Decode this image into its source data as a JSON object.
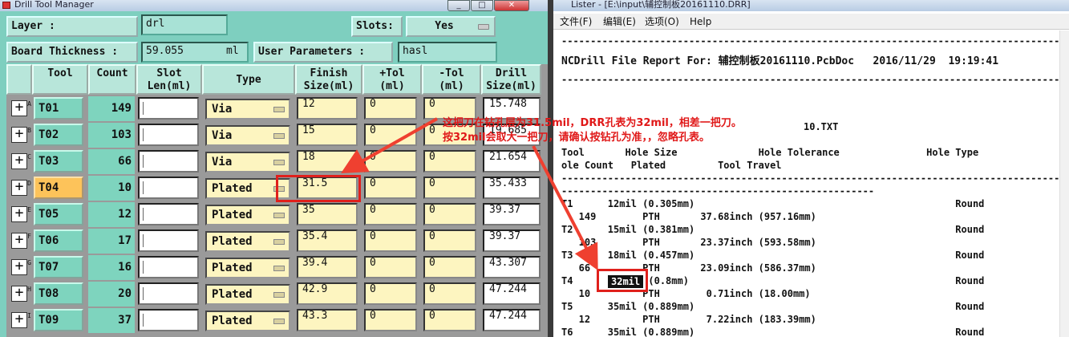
{
  "dtm": {
    "title": "Drill Tool Manager",
    "win_buttons": [
      "_",
      "□",
      "✕"
    ],
    "layer_label": "Layer :",
    "layer_value": "drl",
    "slots_label": "Slots:",
    "slots_value": "Yes",
    "thickness_label": "Board Thickness :",
    "thickness_value": "59.055",
    "thickness_unit": "ml",
    "userparam_label": "User Parameters :",
    "userparam_value": "hasl",
    "headers": {
      "tool": "Tool",
      "count": "Count",
      "slot1": "Slot",
      "slot2": "Len(ml)",
      "type": "Type",
      "finish1": "Finish",
      "finish2": "Size(ml)",
      "ptol1": "+Tol",
      "ptol2": "(ml)",
      "mtol1": "-Tol",
      "mtol2": "(ml)",
      "drill1": "Drill",
      "drill2": "Size(ml)"
    },
    "rows": [
      {
        "tool": "T01",
        "count": "149",
        "type": "Via",
        "finish": "12",
        "ptol": "0",
        "mtol": "0",
        "drill": "15.748",
        "sup": "A"
      },
      {
        "tool": "T02",
        "count": "103",
        "type": "Via",
        "finish": "15",
        "ptol": "0",
        "mtol": "0",
        "drill": "19.685",
        "sup": "B"
      },
      {
        "tool": "T03",
        "count": "66",
        "type": "Via",
        "finish": "18",
        "ptol": "0",
        "mtol": "0",
        "drill": "21.654",
        "sup": "C"
      },
      {
        "tool": "T04",
        "count": "10",
        "type": "Plated",
        "finish": "31.5",
        "ptol": "0",
        "mtol": "0",
        "drill": "35.433",
        "sup": "D"
      },
      {
        "tool": "T05",
        "count": "12",
        "type": "Plated",
        "finish": "35",
        "ptol": "0",
        "mtol": "0",
        "drill": "39.37",
        "sup": "E"
      },
      {
        "tool": "T06",
        "count": "17",
        "type": "Plated",
        "finish": "35.4",
        "ptol": "0",
        "mtol": "0",
        "drill": "39.37",
        "sup": "F"
      },
      {
        "tool": "T07",
        "count": "16",
        "type": "Plated",
        "finish": "39.4",
        "ptol": "0",
        "mtol": "0",
        "drill": "43.307",
        "sup": "G"
      },
      {
        "tool": "T08",
        "count": "20",
        "type": "Plated",
        "finish": "42.9",
        "ptol": "0",
        "mtol": "0",
        "drill": "47.244",
        "sup": "H"
      },
      {
        "tool": "T09",
        "count": "37",
        "type": "Plated",
        "finish": "43.3",
        "ptol": "0",
        "mtol": "0",
        "drill": "47.244",
        "sup": "I"
      }
    ]
  },
  "lister": {
    "title": "Lister - [E:\\input\\辅控制板20161110.DRR]",
    "menu": [
      "文件(F)",
      "编辑(E)",
      "选项(O)",
      "Help"
    ],
    "dash1": "--------------------------------------------------------------------------------------------------",
    "report_title": "NCDrill File Report For: 辅控制板20161110.PcbDoc   2016/11/29  19:19:41",
    "dash2": "--------------------------------------------------------------------------------------------------",
    "file_line": "10.TXT",
    "hdr1": "Tool       Hole Size              Hole Tolerance               Hole Type",
    "hdr2": "ole Count   Plated         Tool Travel",
    "dash3": "--------------------------------------------------------------------------------------------------",
    "dash4": "------------------------------------------------------",
    "entries": [
      {
        "a": "T1      12mil (0.305mm)                                             Round",
        "b": "   149        PTH       37.68inch (957.16mm)"
      },
      {
        "a": "T2      15mil (0.381mm)                                             Round",
        "b": "   103        PTH       23.37inch (593.58mm)"
      },
      {
        "a": "T3      18mil (0.457mm)                                             Round",
        "b": "   66         PTH       23.09inch (586.37mm)"
      },
      {
        "a": "T4             (0.8mm)                                              Round",
        "b": "   10         PTH        0.71inch (18.00mm)"
      },
      {
        "a": "T5      35mil (0.889mm)                                             Round",
        "b": "   12         PTH        7.22inch (183.39mm)"
      },
      {
        "a": "T6      35mil (0.889mm)                                             Round",
        "b": ""
      }
    ],
    "highlight": "32mil"
  },
  "annotation": {
    "line1": "这把刀在钻孔层为31.5mil，DRR孔表为32mil，相差一把刀。",
    "line2": "按32mil会取大一把刀，请确认按钻孔为准，，忽略孔表。"
  },
  "colors": {
    "panel": "#7ecfbf",
    "annotation": "#e01818",
    "selected": "#fdc35a"
  }
}
